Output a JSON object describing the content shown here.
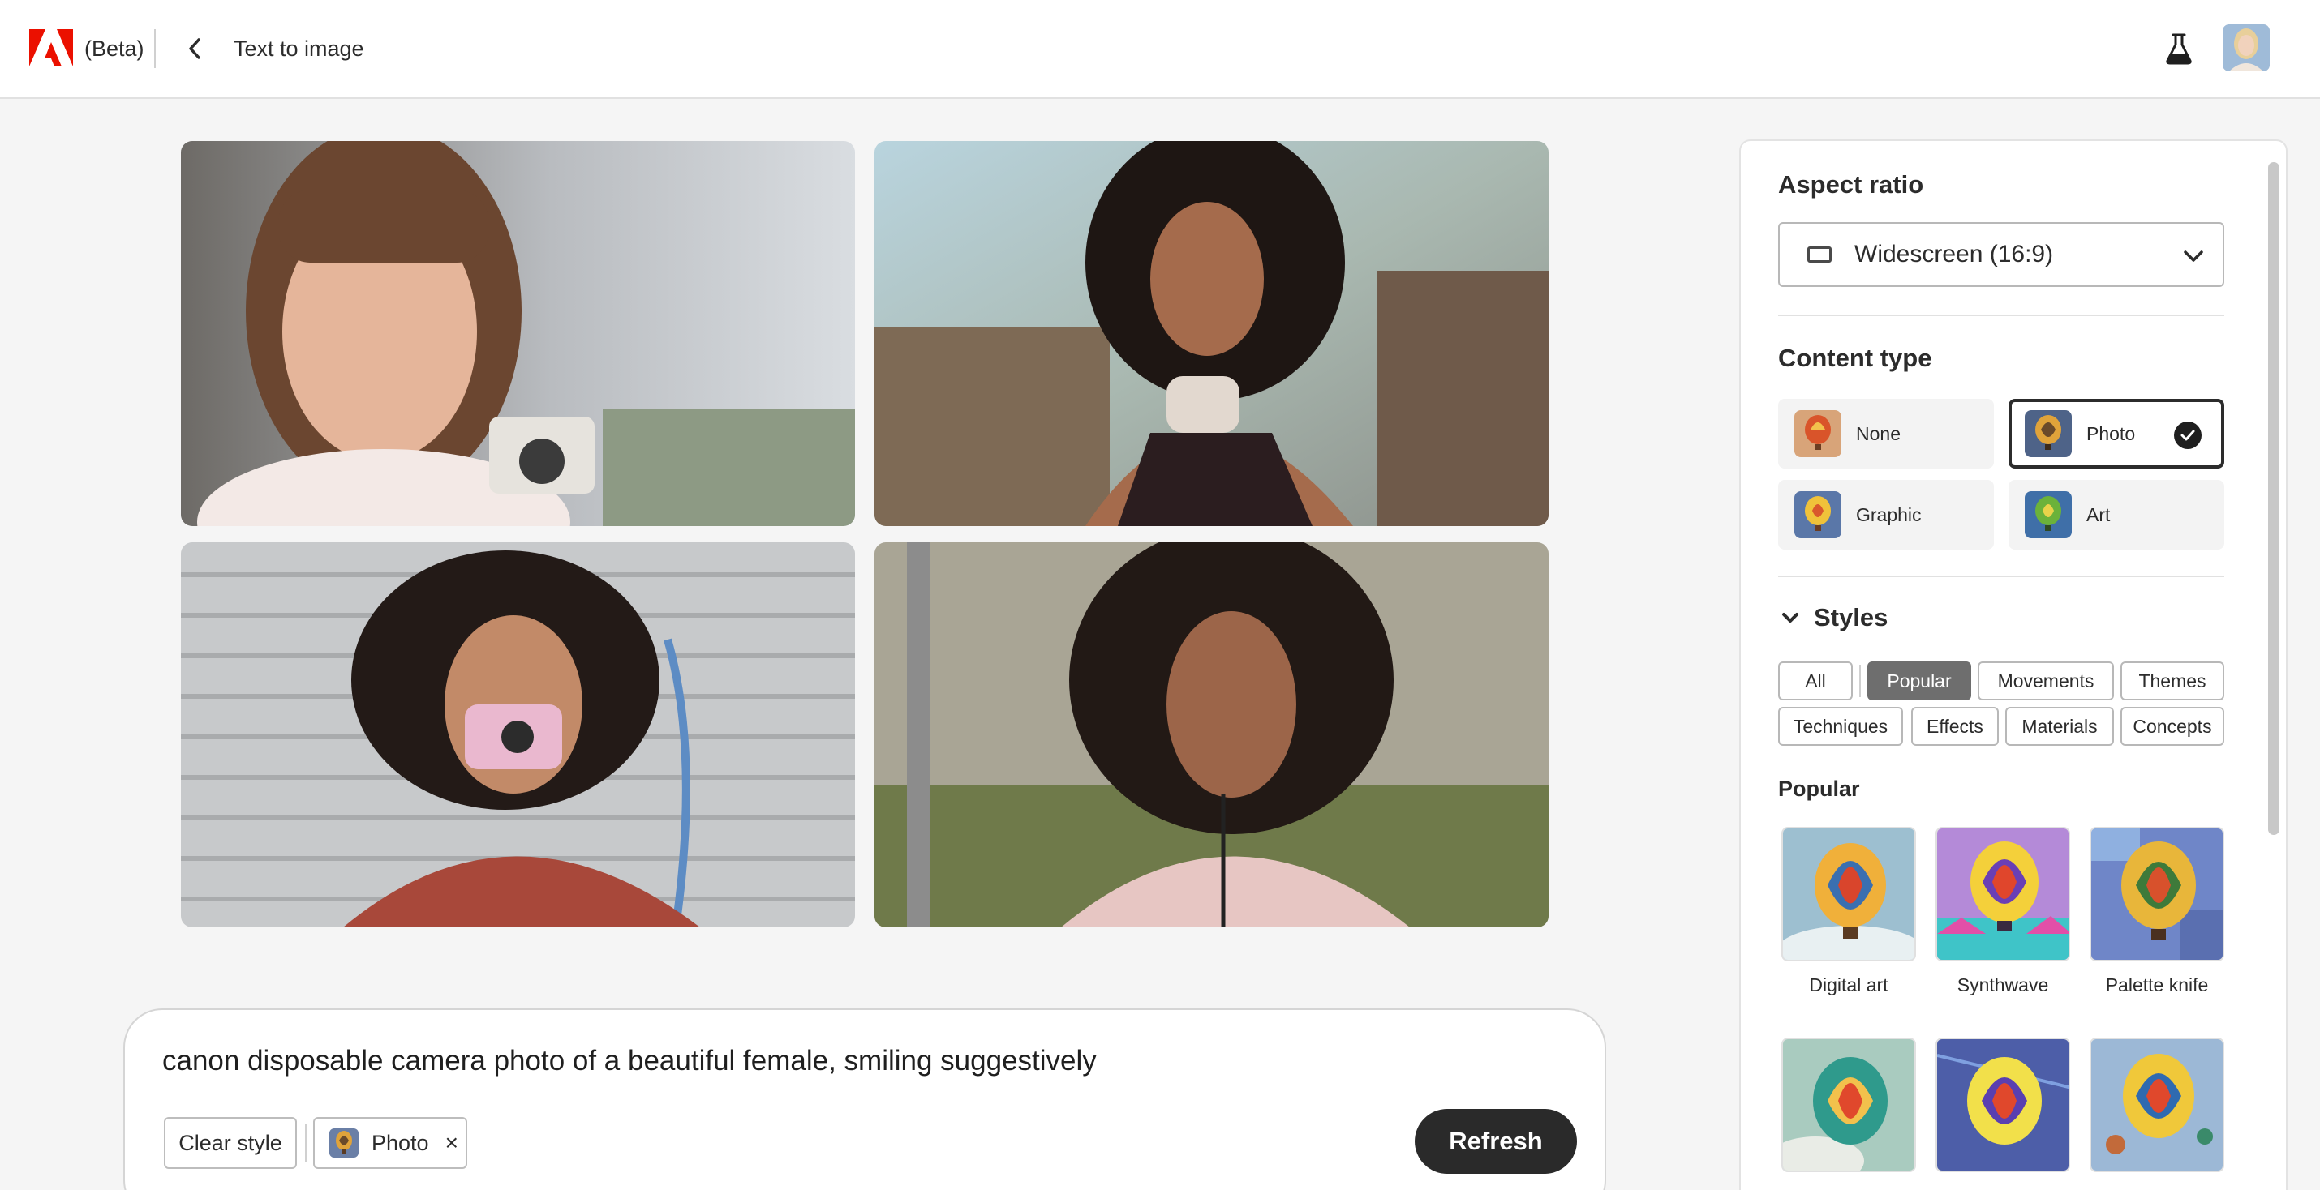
{
  "header": {
    "beta_label": "(Beta)",
    "page_title": "Text to image"
  },
  "colors": {
    "brand_red": "#eb1000",
    "dark_button": "#2a2a2a",
    "active_filter": "#6e6e6e"
  },
  "prompt": {
    "text": "canon disposable camera photo of a beautiful female, smiling suggestively",
    "clear_style_label": "Clear style",
    "applied_style_label": "Photo",
    "remove_symbol": "×",
    "refresh_label": "Refresh"
  },
  "panel": {
    "aspect_ratio_title": "Aspect ratio",
    "aspect_ratio_value": "Widescreen (16:9)",
    "content_type_title": "Content type",
    "content_types": [
      {
        "label": "None",
        "selected": false
      },
      {
        "label": "Photo",
        "selected": true
      },
      {
        "label": "Graphic",
        "selected": false
      },
      {
        "label": "Art",
        "selected": false
      }
    ],
    "styles_title": "Styles",
    "filters": [
      "All",
      "Popular",
      "Movements",
      "Themes",
      "Techniques",
      "Effects",
      "Materials",
      "Concepts"
    ],
    "active_filter": "Popular",
    "popular_title": "Popular",
    "popular_styles": [
      "Digital art",
      "Synthwave",
      "Palette knife"
    ]
  },
  "icons": {
    "logo": "adobe-logo-icon",
    "back": "chevron-left-icon",
    "labs": "flask-icon",
    "dropdown": "chevron-down-icon",
    "aspect": "widescreen-ratio-icon",
    "check": "checkmark-icon",
    "collapse": "chevron-down-icon"
  }
}
